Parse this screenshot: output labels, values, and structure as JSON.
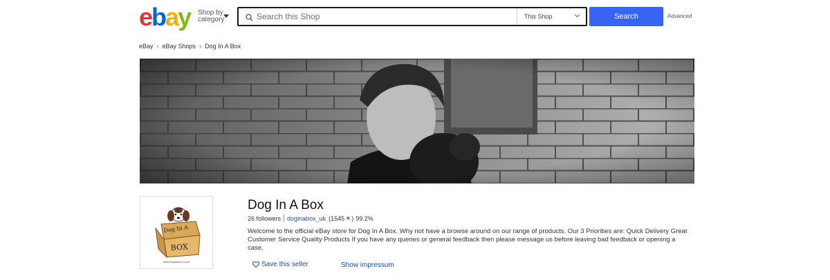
{
  "header": {
    "logo_letters": [
      "e",
      "b",
      "a",
      "y"
    ],
    "logo_colors": [
      "#e53238",
      "#0064d2",
      "#f5af02",
      "#86b817"
    ],
    "shop_by_line1": "Shop by",
    "shop_by_line2": "category",
    "search_placeholder": "Search this Shop",
    "scope_selected": "This Shop",
    "search_button": "Search",
    "advanced_link": "Advanced"
  },
  "breadcrumb": [
    "eBay",
    "eBay Shops",
    "Dog In A Box"
  ],
  "banner": {
    "alt": "Black and white photo of a young man holding a dog against a brick wall"
  },
  "store": {
    "logo_text_top": "Dog In A",
    "logo_text_box": "BOX",
    "logo_url_text": "www.doginabox.co.uk",
    "name": "Dog In A Box",
    "followers": "26 followers",
    "seller_id": "doginabox_uk",
    "feedback_count_open": "(1545",
    "feedback_count_close": ")",
    "feedback_percent": "99.2%",
    "description": "Welcome to the official eBay store for Dog In A Box. Why not have a browse around on our range of products. Our 3 Priorities are: Quick Delivery Great Customer Service Quality Products If you have any queries or general feedback then please message us before leaving bad feedback or opening a case.",
    "save_seller": "Save this seller",
    "impressum": "Show impressum"
  },
  "colors": {
    "accent": "#3665f3",
    "link": "#1a4ea1",
    "star": "#d65b1a"
  }
}
